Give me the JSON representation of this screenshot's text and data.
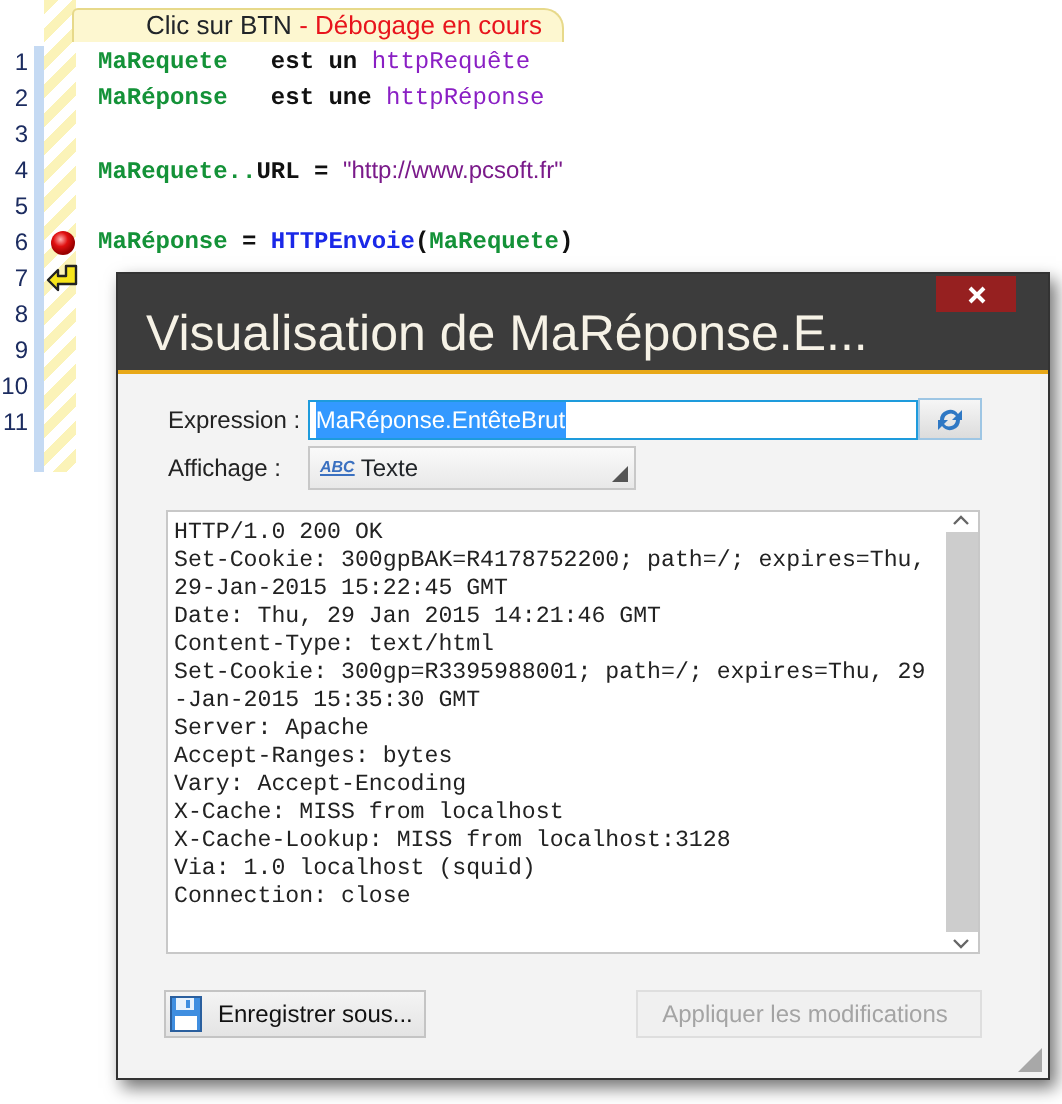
{
  "editor": {
    "tab": {
      "title": "Clic sur BTN",
      "status": "- Débogage en cours"
    },
    "lines": [
      {
        "number": "1",
        "tokens": [
          {
            "kind": "var",
            "text": "MaRequete"
          },
          {
            "kind": "plain",
            "text": "   est un "
          },
          {
            "kind": "type",
            "text": "httpRequête"
          }
        ]
      },
      {
        "number": "2",
        "tokens": [
          {
            "kind": "var",
            "text": "MaRéponse"
          },
          {
            "kind": "plain",
            "text": "   est une "
          },
          {
            "kind": "type",
            "text": "httpRéponse"
          }
        ]
      },
      {
        "number": "3"
      },
      {
        "number": "4",
        "tokens": [
          {
            "kind": "var",
            "text": "MaRequete.."
          },
          {
            "kind": "plain",
            "text": "URL = "
          },
          {
            "kind": "string",
            "text": "\"http://www.pcsoft.fr\""
          }
        ]
      },
      {
        "number": "5"
      },
      {
        "number": "6",
        "breakpoint": true,
        "tokens": [
          {
            "kind": "var",
            "text": "MaRéponse"
          },
          {
            "kind": "plain",
            "text": " = "
          },
          {
            "kind": "func",
            "text": "HTTPEnvoie"
          },
          {
            "kind": "plain",
            "text": "("
          },
          {
            "kind": "var",
            "text": "MaRequete"
          },
          {
            "kind": "plain",
            "text": ")"
          }
        ]
      },
      {
        "number": "7",
        "current_line": true
      },
      {
        "number": "8"
      },
      {
        "number": "9"
      },
      {
        "number": "10"
      },
      {
        "number": "11"
      }
    ]
  },
  "dialog": {
    "title": "Visualisation de MaRéponse.E...",
    "expression": {
      "label": "Expression :",
      "value": "MaRéponse.EntêteBrut",
      "text_selected": true
    },
    "display": {
      "label": "Affichage :",
      "type_badge": "ABC",
      "value": "Texte"
    },
    "content_lines": [
      "HTTP/1.0 200 OK",
      "Set-Cookie: 300gpBAK=R4178752200; path=/; expires=Thu,",
      "29-Jan-2015 15:22:45 GMT",
      "Date: Thu, 29 Jan 2015 14:21:46 GMT",
      "Content-Type: text/html",
      "Set-Cookie: 300gp=R3395988001; path=/; expires=Thu, 29",
      "-Jan-2015 15:35:30 GMT",
      "Server: Apache",
      "Accept-Ranges: bytes",
      "Vary: Accept-Encoding",
      "X-Cache: MISS from localhost",
      "X-Cache-Lookup: MISS from localhost:3128",
      "Via: 1.0 localhost (squid)",
      "Connection: close"
    ],
    "buttons": [
      {
        "kind": "save",
        "label": "Enregistrer sous...",
        "disabled": false
      },
      {
        "kind": "apply",
        "label": "Appliquer les modifications",
        "disabled": true
      }
    ]
  }
}
